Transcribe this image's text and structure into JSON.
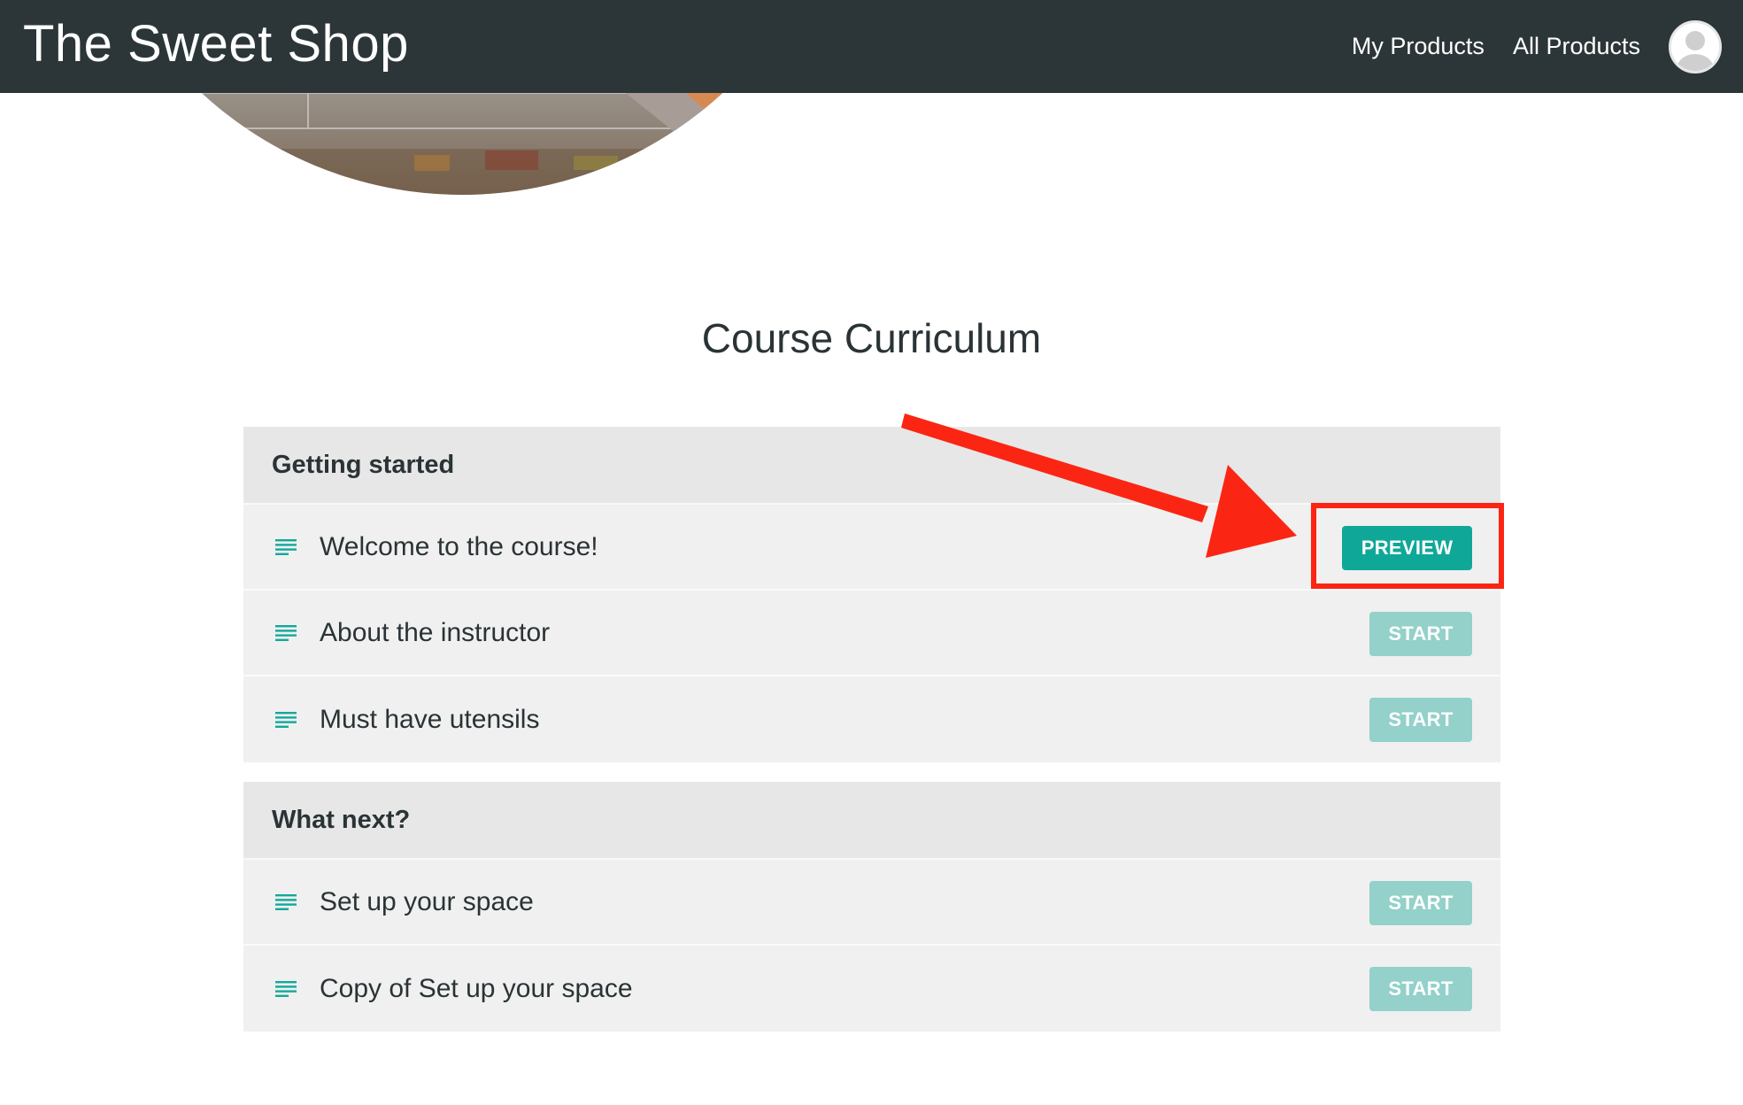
{
  "header": {
    "brand": "The Sweet Shop",
    "nav": [
      {
        "label": "My Products"
      },
      {
        "label": "All Products"
      }
    ]
  },
  "page": {
    "title": "Course Curriculum"
  },
  "sections": [
    {
      "title": "Getting started",
      "lectures": [
        {
          "title": "Welcome to the course!",
          "action": "PREVIEW"
        },
        {
          "title": "About the instructor",
          "action": "START"
        },
        {
          "title": "Must have utensils",
          "action": "START"
        }
      ]
    },
    {
      "title": "What next?",
      "lectures": [
        {
          "title": "Set up your space",
          "action": "START"
        },
        {
          "title": "Copy of Set up your space",
          "action": "START"
        }
      ]
    }
  ],
  "colors": {
    "navbar": "#2c3638",
    "accent": "#0fa898",
    "accent_light": "#93d1ca",
    "annotation": "#fa2613"
  },
  "icons": {
    "lecture": "text-lines-icon",
    "avatar": "user-avatar-icon"
  }
}
